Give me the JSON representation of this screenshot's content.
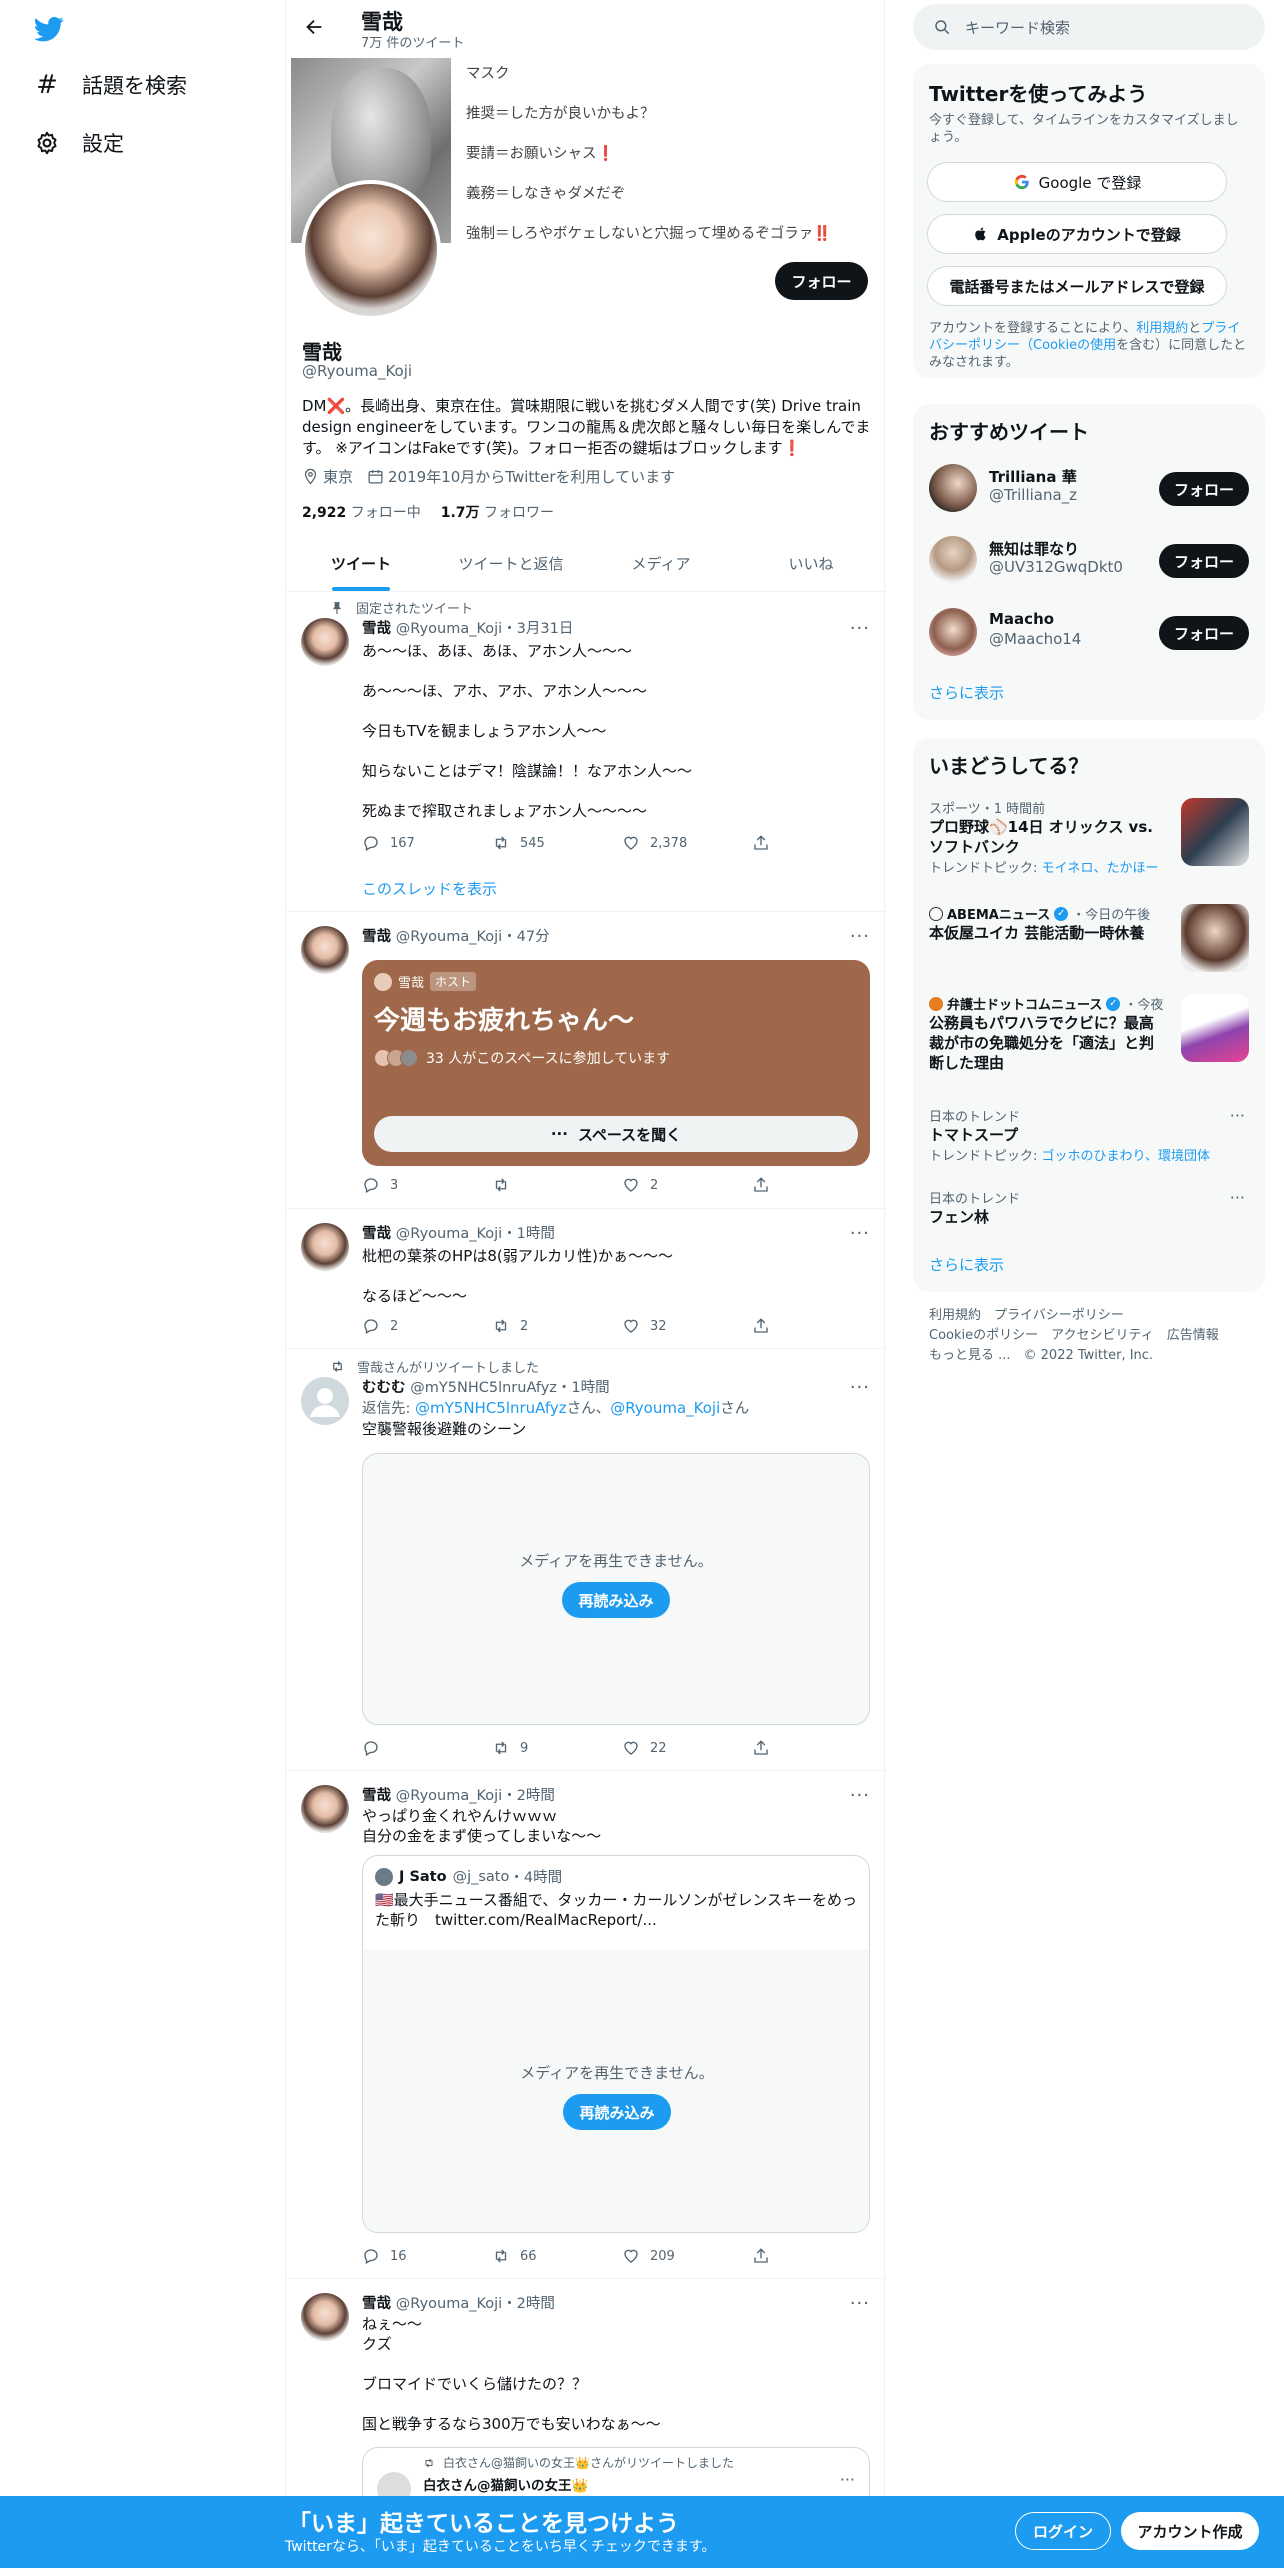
{
  "nav": {
    "explore": "話題を検索",
    "settings": "設定"
  },
  "header": {
    "title": "雪哉",
    "subtitle": "7万 件のツイート"
  },
  "banner_text": [
    "マスク",
    "推奨＝した方が良いかもよ？",
    "要請＝お願いシャス❗",
    "義務＝しなきゃダメだぞ",
    "強制＝しろやボケェしないと穴掘って埋めるぞゴラァ‼️"
  ],
  "profile": {
    "follow_button": "フォロー",
    "name": "雪哉",
    "handle": "@Ryouma_Koji",
    "bio": "DM❌。長崎出身、東京在住。賞味期限に戦いを挑むダメ人間です(笑) Drive train design engineerをしています。ワンコの龍馬＆虎次郎と騒々しい毎日を楽しんでます。 ※アイコンはFakeです(笑)。フォロー拒否の鍵垢はブロックします❗",
    "location": "東京",
    "joined": "2019年10月からTwitterを利用しています",
    "following_count": "2,922",
    "following_label": "フォロー中",
    "followers_count": "1.7万",
    "followers_label": "フォロワー"
  },
  "tabs": [
    "ツイート",
    "ツイートと返信",
    "メディア",
    "いいね"
  ],
  "tweets": {
    "t1": {
      "pinned": "固定されたツイート",
      "name": "雪哉",
      "handle": "@Ryouma_Koji",
      "time": "・3月31日",
      "lines": [
        "あ～～ほ、あほ、あほ、アホン人～～～",
        "",
        "あ～～～ほ、アホ、アホ、アホン人～～～",
        "",
        "今日もTVを観ましょうアホン人～～",
        "",
        "知らないことはデマ！陰謀論！！なアホン人～～",
        "",
        "死ぬまで搾取されましょアホン人～～～～"
      ],
      "replies": "167",
      "retweets": "545",
      "likes": "2,378",
      "thread": "このスレッドを表示"
    },
    "t2": {
      "name": "雪哉",
      "handle": "@Ryouma_Koji",
      "time": "・47分",
      "space_host": "雪哉",
      "space_badge": "ホスト",
      "space_title": "今週もお疲れちゃん〜",
      "space_listeners": "33 人がこのスペースに参加しています",
      "space_button": "スペースを聞く",
      "replies": "3",
      "retweets": "",
      "likes": "2"
    },
    "t3": {
      "name": "雪哉",
      "handle": "@Ryouma_Koji",
      "time": "・1時間",
      "lines": [
        "枇杷の葉茶のHPは8(弱アルカリ性)かぁ～～～",
        "",
        "なるほど～～～"
      ],
      "replies": "2",
      "retweets": "2",
      "likes": "32"
    },
    "t4": {
      "retweeted_by": "雪哉さんがリツイートしました",
      "name": "むむむ",
      "handle": "@mY5NHC5lnruAfyz",
      "time": "・1時間",
      "reply_prefix": "返信先: ",
      "reply_to_1": "@mY5NHC5lnruAfyz",
      "san1": "さん、",
      "reply_to_2": "@Ryouma_Koji",
      "san2": "さん",
      "text": "空襲警報後避難のシーン",
      "media_msg": "メディアを再生できません。",
      "reload": "再読み込み",
      "replies": "",
      "retweets": "9",
      "likes": "22"
    },
    "t5": {
      "name": "雪哉",
      "handle": "@Ryouma_Koji",
      "time": "・2時間",
      "lines": [
        "やっぱり金くれやんけｗｗｗ",
        "自分の金をまず使ってしまいな～～"
      ],
      "quote_name": "J Sato",
      "quote_handle": "@j_sato",
      "quote_time": "・4時間",
      "quote_text": "🇺🇸最大手ニュース番組で、タッカー・カールソンがゼレンスキーをめった斬り　twitter.com/RealMacReport/...",
      "media_msg": "メディアを再生できません。",
      "reload": "再読み込み",
      "replies": "16",
      "retweets": "66",
      "likes": "209"
    },
    "t6": {
      "name": "雪哉",
      "handle": "@Ryouma_Koji",
      "time": "・2時間",
      "lines": [
        "ねぇ～～",
        "クズ",
        "",
        "ブロマイドでいくら儲けたの？？",
        "",
        "国と戦争するなら300万でも安いわなぁ～～"
      ],
      "quote_rt": "白衣さん@猫飼いの女王👑さんがリツイートしました",
      "quote_name": "白衣さん@猫飼いの女王👑"
    }
  },
  "sidebar": {
    "search_placeholder": "キーワード検索",
    "signup": {
      "title": "Twitterを使ってみよう",
      "subtitle": "今すぐ登録して、タイムラインをカスタマイズしましょう。",
      "google": "Google で登録",
      "apple": "Appleのアカウントで登録",
      "phone": "電話番号またはメールアドレスで登録",
      "terms_1": "アカウントを登録することにより、",
      "terms_link1": "利用規約",
      "terms_2": "と",
      "terms_link2": "プライバシーポリシー（Cookieの使用",
      "terms_3": "を含む）に同意したとみなされます。"
    },
    "who": {
      "title": "おすすめツイート",
      "users": [
        {
          "name": "Trilliana 華",
          "handle": "@Trilliana_z",
          "button": "フォロー"
        },
        {
          "name": "無知は罪なり",
          "handle": "@UV312GwqDkt0",
          "button": "フォロー"
        },
        {
          "name": "Maacho",
          "handle": "@Maacho14",
          "button": "フォロー"
        }
      ],
      "more": "さらに表示"
    },
    "trends": {
      "title": "いまどうしてる？",
      "items": [
        {
          "cat": "スポーツ・1 時間前",
          "title": "プロ野球⚾14日 オリックス vs. ソフトバンク",
          "topic_label": "トレンドトピック: ",
          "topic": "モイネロ、たかほー"
        },
        {
          "cat": "ABEMAニュース",
          "cat2": "・今日の午後",
          "title": "本仮屋ユイカ 芸能活動一時休養"
        },
        {
          "cat": "弁護士ドットコムニュース",
          "cat2": "・今夜",
          "title": "公務員もパワハラでクビに？最高裁が市の免職処分を「適法」と判断した理由"
        },
        {
          "cat": "日本のトレンド",
          "title": "トマトスープ",
          "topic_label": "トレンドトピック: ",
          "topic": "ゴッホのひまわり、環境団体"
        },
        {
          "cat": "日本のトレンド",
          "title": "フェン林"
        }
      ],
      "more": "さらに表示"
    },
    "footer": {
      "line1": "利用規約　プライバシーポリシー",
      "line2": "Cookieのポリシー　アクセシビリティ　広告情報",
      "line3": "もっと見る ...　© 2022 Twitter, Inc."
    }
  },
  "bottom": {
    "title": "「いま」起きていることを見つけよう",
    "subtitle": "Twitterなら、「いま」起きていることをいち早くチェックできます。",
    "login": "ログイン",
    "signup": "アカウント作成"
  },
  "colors": {
    "accent": "#1d9bf0",
    "space": "#a0684a",
    "text": "#0f1419",
    "muted": "#536471"
  }
}
